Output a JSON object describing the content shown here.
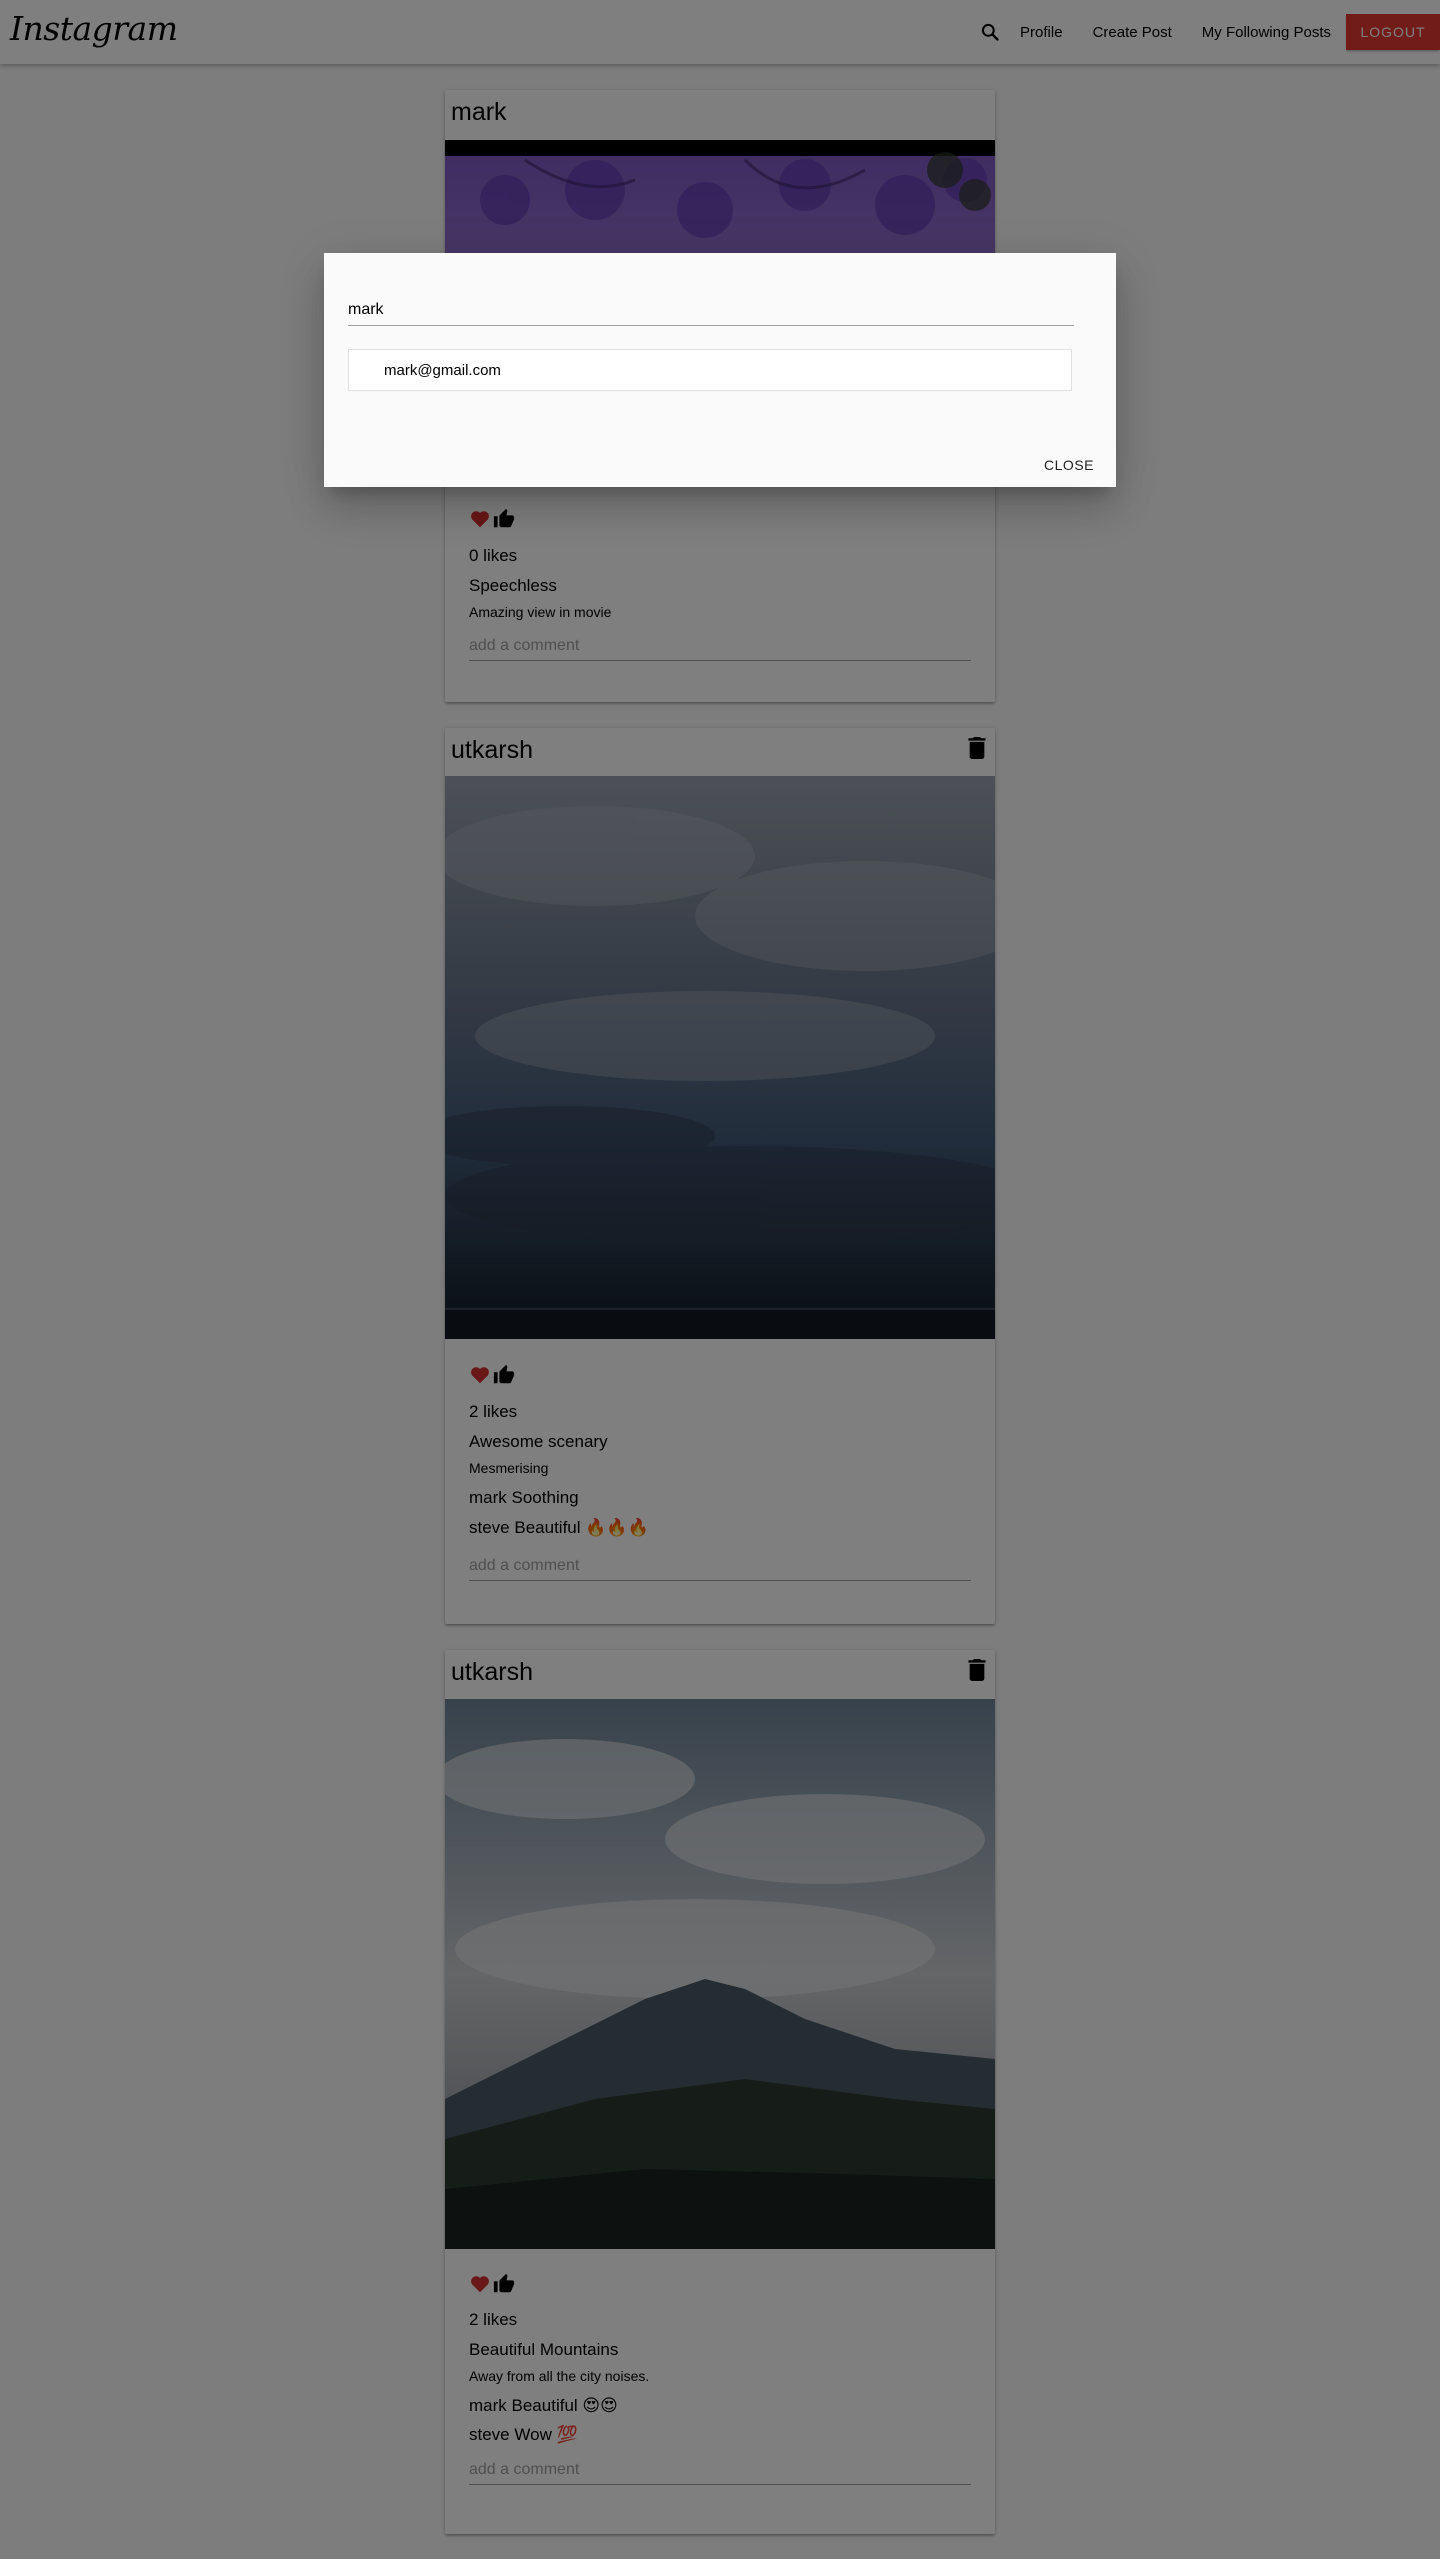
{
  "navbar": {
    "brand": "Instagram",
    "search_icon": "search-icon",
    "links": [
      "Profile",
      "Create Post",
      "My Following Posts"
    ],
    "logout_label": "LOGOUT",
    "logout_color": "#e53935"
  },
  "posts": [
    {
      "author": "mark",
      "can_delete": false,
      "image": "purple wisteria flowers",
      "likes": "0 likes",
      "title": "Speechless",
      "body": "Amazing view in movie",
      "comments": [],
      "comment_placeholder": "add a comment"
    },
    {
      "author": "utkarsh",
      "can_delete": true,
      "image": "stormy clouds over sea",
      "likes": "2 likes",
      "title": "Awesome scenary",
      "body": "Mesmerising",
      "comments": [
        {
          "user": "mark",
          "text": "Soothing"
        },
        {
          "user": "steve",
          "text": "Beautiful 🔥🔥🔥"
        }
      ],
      "comment_placeholder": "add a comment"
    },
    {
      "author": "utkarsh",
      "can_delete": true,
      "image": "mountain under clouds",
      "likes": "2 likes",
      "title": "Beautiful Mountains",
      "body": "Away from all the city noises.",
      "comments": [
        {
          "user": "mark",
          "text": "Beautiful 😍😍"
        },
        {
          "user": "steve",
          "text": "Wow 💯"
        }
      ],
      "comment_placeholder": "add a comment"
    }
  ],
  "icons": {
    "like": "heart-icon",
    "thumb": "thumbs-up-icon",
    "delete": "trash-icon"
  },
  "colors": {
    "heart": "#d32f2f",
    "overlay": "rgba(0,0,0,0.5)"
  },
  "search_modal": {
    "query": "mark",
    "results": [
      "mark@gmail.com"
    ],
    "close_label": "CLOSE"
  }
}
